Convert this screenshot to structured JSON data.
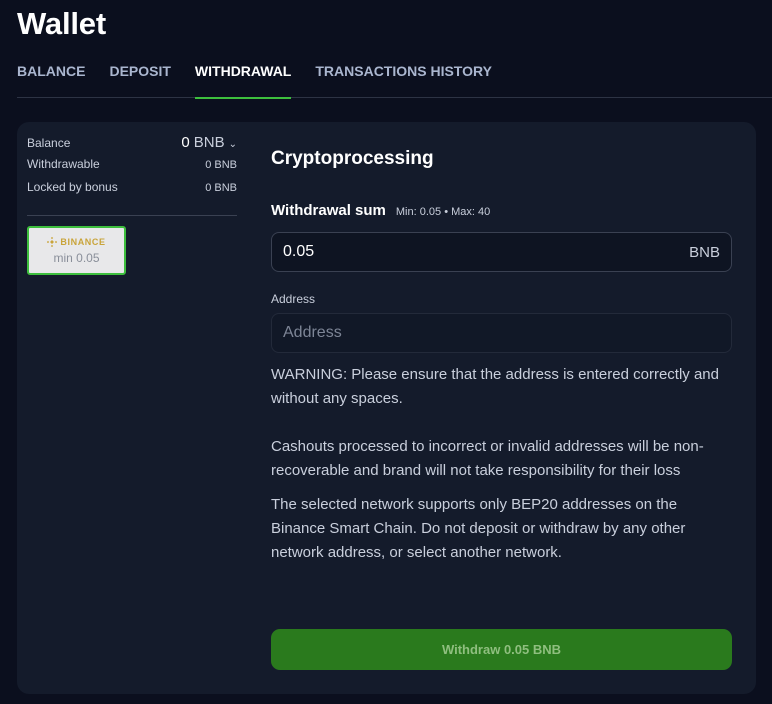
{
  "page": {
    "title": "Wallet"
  },
  "tabs": [
    {
      "label": "BALANCE"
    },
    {
      "label": "DEPOSIT"
    },
    {
      "label": "WITHDRAWAL",
      "active": true
    },
    {
      "label": "TRANSACTIONS HISTORY"
    }
  ],
  "balance": {
    "balance_label": "Balance",
    "balance_value": "0",
    "currency": "BNB",
    "withdrawable_label": "Withdrawable",
    "withdrawable_value": "0 BNB",
    "locked_label": "Locked by bonus",
    "locked_value": "0 BNB"
  },
  "method": {
    "logo_text": "BINANCE",
    "min_text": "min 0.05",
    "selected": true
  },
  "form": {
    "section_title": "Cryptoprocessing",
    "sum_label": "Withdrawal sum",
    "sum_hint": "Min: 0.05 • Max: 40",
    "sum_value": "0.05",
    "sum_unit": "BNB",
    "address_label": "Address",
    "address_placeholder": "Address",
    "address_value": "",
    "warning_text": "WARNING: Please ensure that the address is entered correctly and without any spaces.",
    "cashout_text": "Cashouts processed to incorrect or invalid addresses will be non-recoverable and brand will not take responsibility for their loss",
    "network_text": "The selected network supports only BEP20 addresses on the Binance Smart Chain. Do not deposit or withdraw by any other network address, or select another network.",
    "submit_label": "Withdraw 0.05 BNB"
  },
  "colors": {
    "background": "#0b0f1e",
    "panel": "#141b2b",
    "accent_green": "#3dbf3d",
    "button_green": "#2a7a1d",
    "binance_gold": "#c9a43a"
  },
  "icons": {
    "currency_dropdown": "chevron-down-icon",
    "binance": "binance-logo-icon"
  }
}
